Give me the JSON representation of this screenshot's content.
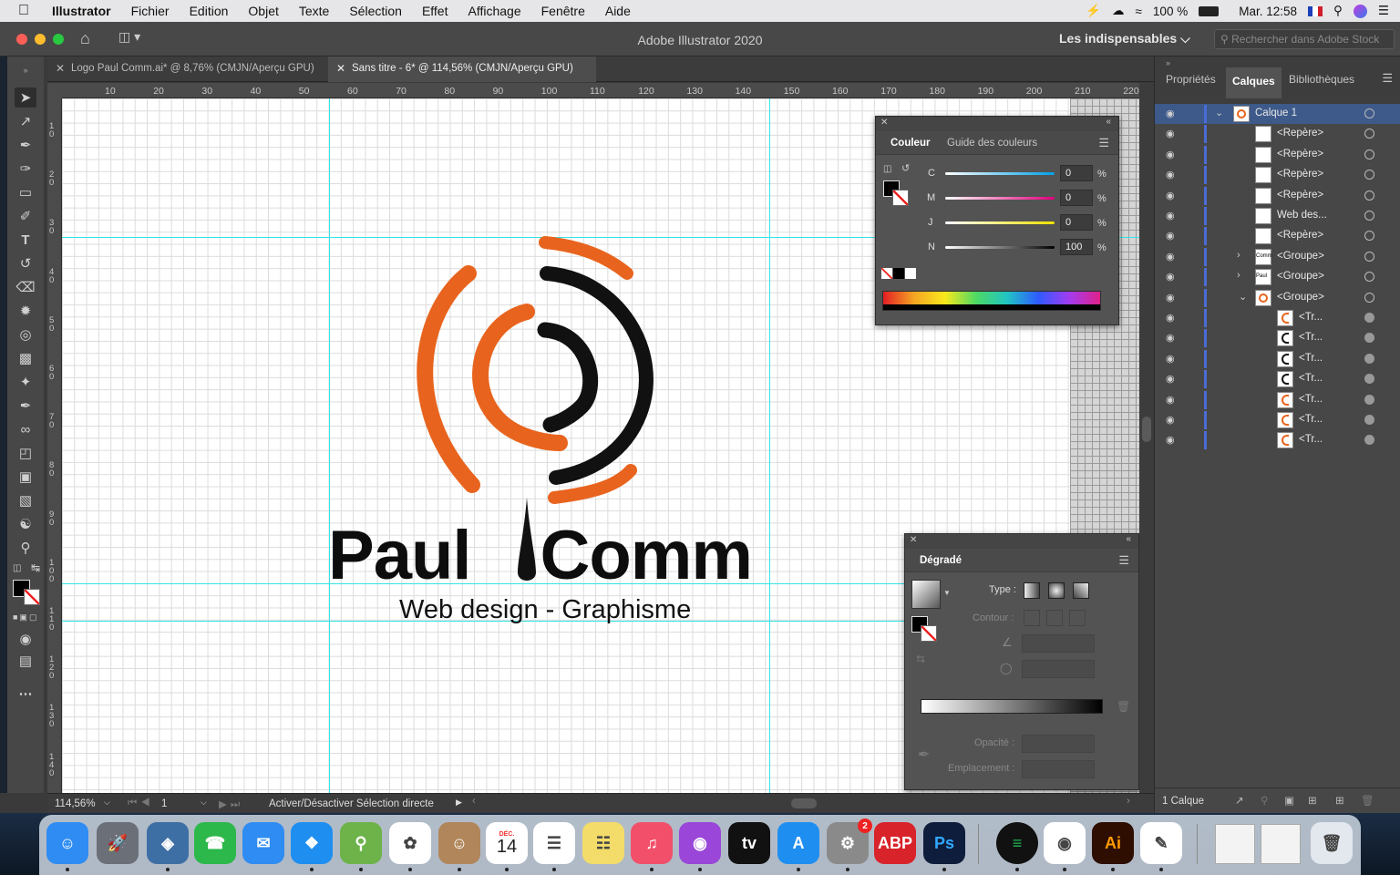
{
  "menubar": {
    "app": "Illustrator",
    "items": [
      "Fichier",
      "Edition",
      "Objet",
      "Texte",
      "Sélection",
      "Effet",
      "Affichage",
      "Fenêtre",
      "Aide"
    ],
    "battery": "100 %",
    "clock": "Mar. 12:58"
  },
  "window": {
    "title": "Adobe Illustrator 2020",
    "workspace": "Les indispensables",
    "stock_placeholder": "Rechercher dans Adobe Stock"
  },
  "tabs": [
    {
      "label": "Logo Paul Comm.ai* @ 8,76% (CMJN/Aperçu GPU)"
    },
    {
      "label": "Sans titre - 6* @ 114,56% (CMJN/Aperçu GPU)"
    }
  ],
  "ruler_h": [
    "10",
    "20",
    "30",
    "40",
    "50",
    "60",
    "70",
    "80",
    "90",
    "100",
    "110",
    "120",
    "130",
    "140",
    "150",
    "160",
    "170",
    "180",
    "190",
    "200",
    "210",
    "220"
  ],
  "ruler_v": [
    "10",
    "20",
    "30",
    "40",
    "50",
    "60",
    "70",
    "80",
    "90",
    "100",
    "110",
    "120",
    "130",
    "140"
  ],
  "artwork": {
    "wordmark_left": "Paul",
    "wordmark_right": "Comm",
    "tagline": "Web design - Graphisme",
    "orange": "#e8641e",
    "black": "#111111"
  },
  "color_panel": {
    "tabs": [
      "Couleur",
      "Guide des couleurs"
    ],
    "channels": [
      {
        "label": "C",
        "value": "0"
      },
      {
        "label": "M",
        "value": "0"
      },
      {
        "label": "J",
        "value": "0"
      },
      {
        "label": "N",
        "value": "100"
      }
    ],
    "percent": "%"
  },
  "gradient_panel": {
    "title": "Dégradé",
    "type_label": "Type :",
    "contour_label": "Contour :",
    "opacity_label": "Opacité :",
    "location_label": "Emplacement :"
  },
  "layers_panel": {
    "tabs": [
      "Propriétés",
      "Calques",
      "Bibliothèques"
    ],
    "rows": [
      {
        "name": "Calque 1",
        "kind": "layer"
      },
      {
        "name": "<Repère>",
        "kind": "item"
      },
      {
        "name": "<Repère>",
        "kind": "item"
      },
      {
        "name": "<Repère>",
        "kind": "item"
      },
      {
        "name": "<Repère>",
        "kind": "item"
      },
      {
        "name": "Web des...",
        "kind": "item"
      },
      {
        "name": "<Repère>",
        "kind": "item"
      },
      {
        "name": "<Groupe>",
        "kind": "group-collapsed",
        "thumb": "Comm"
      },
      {
        "name": "<Groupe>",
        "kind": "group-collapsed",
        "thumb": "Paul"
      },
      {
        "name": "<Groupe>",
        "kind": "group-open"
      },
      {
        "name": "<Tr...",
        "kind": "sub"
      },
      {
        "name": "<Tr...",
        "kind": "sub"
      },
      {
        "name": "<Tr...",
        "kind": "sub"
      },
      {
        "name": "<Tr...",
        "kind": "sub"
      },
      {
        "name": "<Tr...",
        "kind": "sub"
      },
      {
        "name": "<Tr...",
        "kind": "sub"
      },
      {
        "name": "<Tr...",
        "kind": "sub"
      }
    ],
    "footer": "1 Calque"
  },
  "status": {
    "zoom": "114,56%",
    "artboard": "1",
    "message": "Activer/Désactiver Sélection directe"
  },
  "dock": {
    "calendar_month": "DÉC.",
    "calendar_day": "14",
    "prefs_badge": "2",
    "apps": [
      "Finder",
      "Launchpad",
      "Aperçu",
      "FaceTime",
      "Messages",
      "Safari",
      "Plans",
      "Photos",
      "Contacts",
      "Calendrier",
      "Rappels",
      "Notes",
      "Musique",
      "Podcasts",
      "TV",
      "App Store",
      "Préférences Système",
      "AdBlock",
      "Photoshop",
      "Spotify",
      "Chrome",
      "Illustrator",
      "TextEdit",
      "Corbeille"
    ]
  }
}
